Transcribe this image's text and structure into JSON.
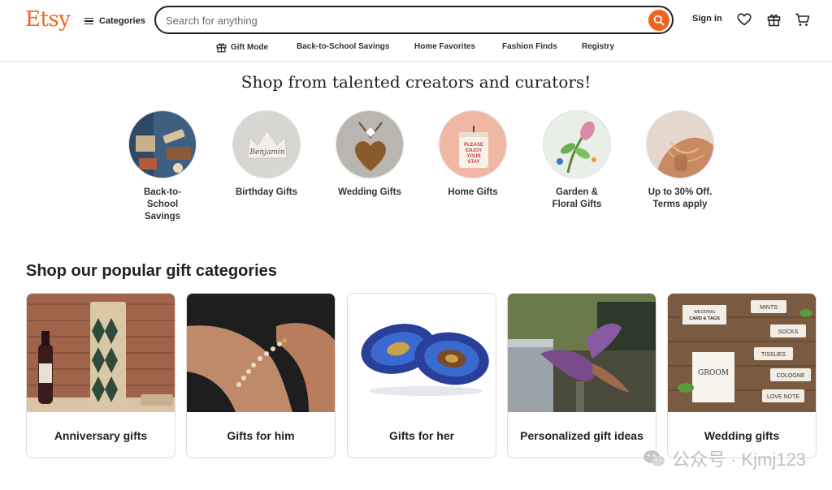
{
  "header": {
    "logo": "Etsy",
    "categories_label": "Categories",
    "search_placeholder": "Search for anything",
    "signin_label": "Sign in",
    "accent": "#f1641e"
  },
  "subnav": {
    "gift_mode": "Gift Mode",
    "back_to_school": "Back-to-School Savings",
    "home_favorites": "Home Favorites",
    "fashion_finds": "Fashion Finds",
    "registry": "Registry"
  },
  "hero": {
    "title": "Shop from talented creators and curators!",
    "items": [
      {
        "line1": "Back-to-",
        "line2": "School",
        "line3": "Savings"
      },
      {
        "line1": "Birthday Gifts"
      },
      {
        "line1": "Wedding Gifts"
      },
      {
        "line1": "Home Gifts"
      },
      {
        "line1": "Garden &",
        "line2": "Floral Gifts"
      },
      {
        "line1": "Up to 30% Off.",
        "line2": "Terms apply"
      }
    ],
    "circle_images": {
      "birthday_text": "Benjamin",
      "home_text_1": "PLEASE",
      "home_text_2": "ENJOY",
      "home_text_3": "YOUR",
      "home_text_4": "STAY"
    }
  },
  "popular": {
    "title": "Shop our popular gift categories",
    "cards": [
      {
        "label": "Anniversary gifts"
      },
      {
        "label": "Gifts for him"
      },
      {
        "label": "Gifts for her"
      },
      {
        "label": "Personalized gift ideas"
      },
      {
        "label": "Wedding gifts"
      }
    ],
    "wedding_tags": {
      "sign_1": "WEDDING",
      "sign_2": "CARD & TAGS",
      "tag_mints": "MINTS",
      "tag_socks": "SOCKS",
      "tag_tissues": "TISSUES",
      "tag_cologne": "COLOGNE",
      "tag_love": "LOVE NOTE",
      "card_groom": "GROOM"
    }
  },
  "watermark": {
    "text": "公众号 · Kjmj123"
  }
}
